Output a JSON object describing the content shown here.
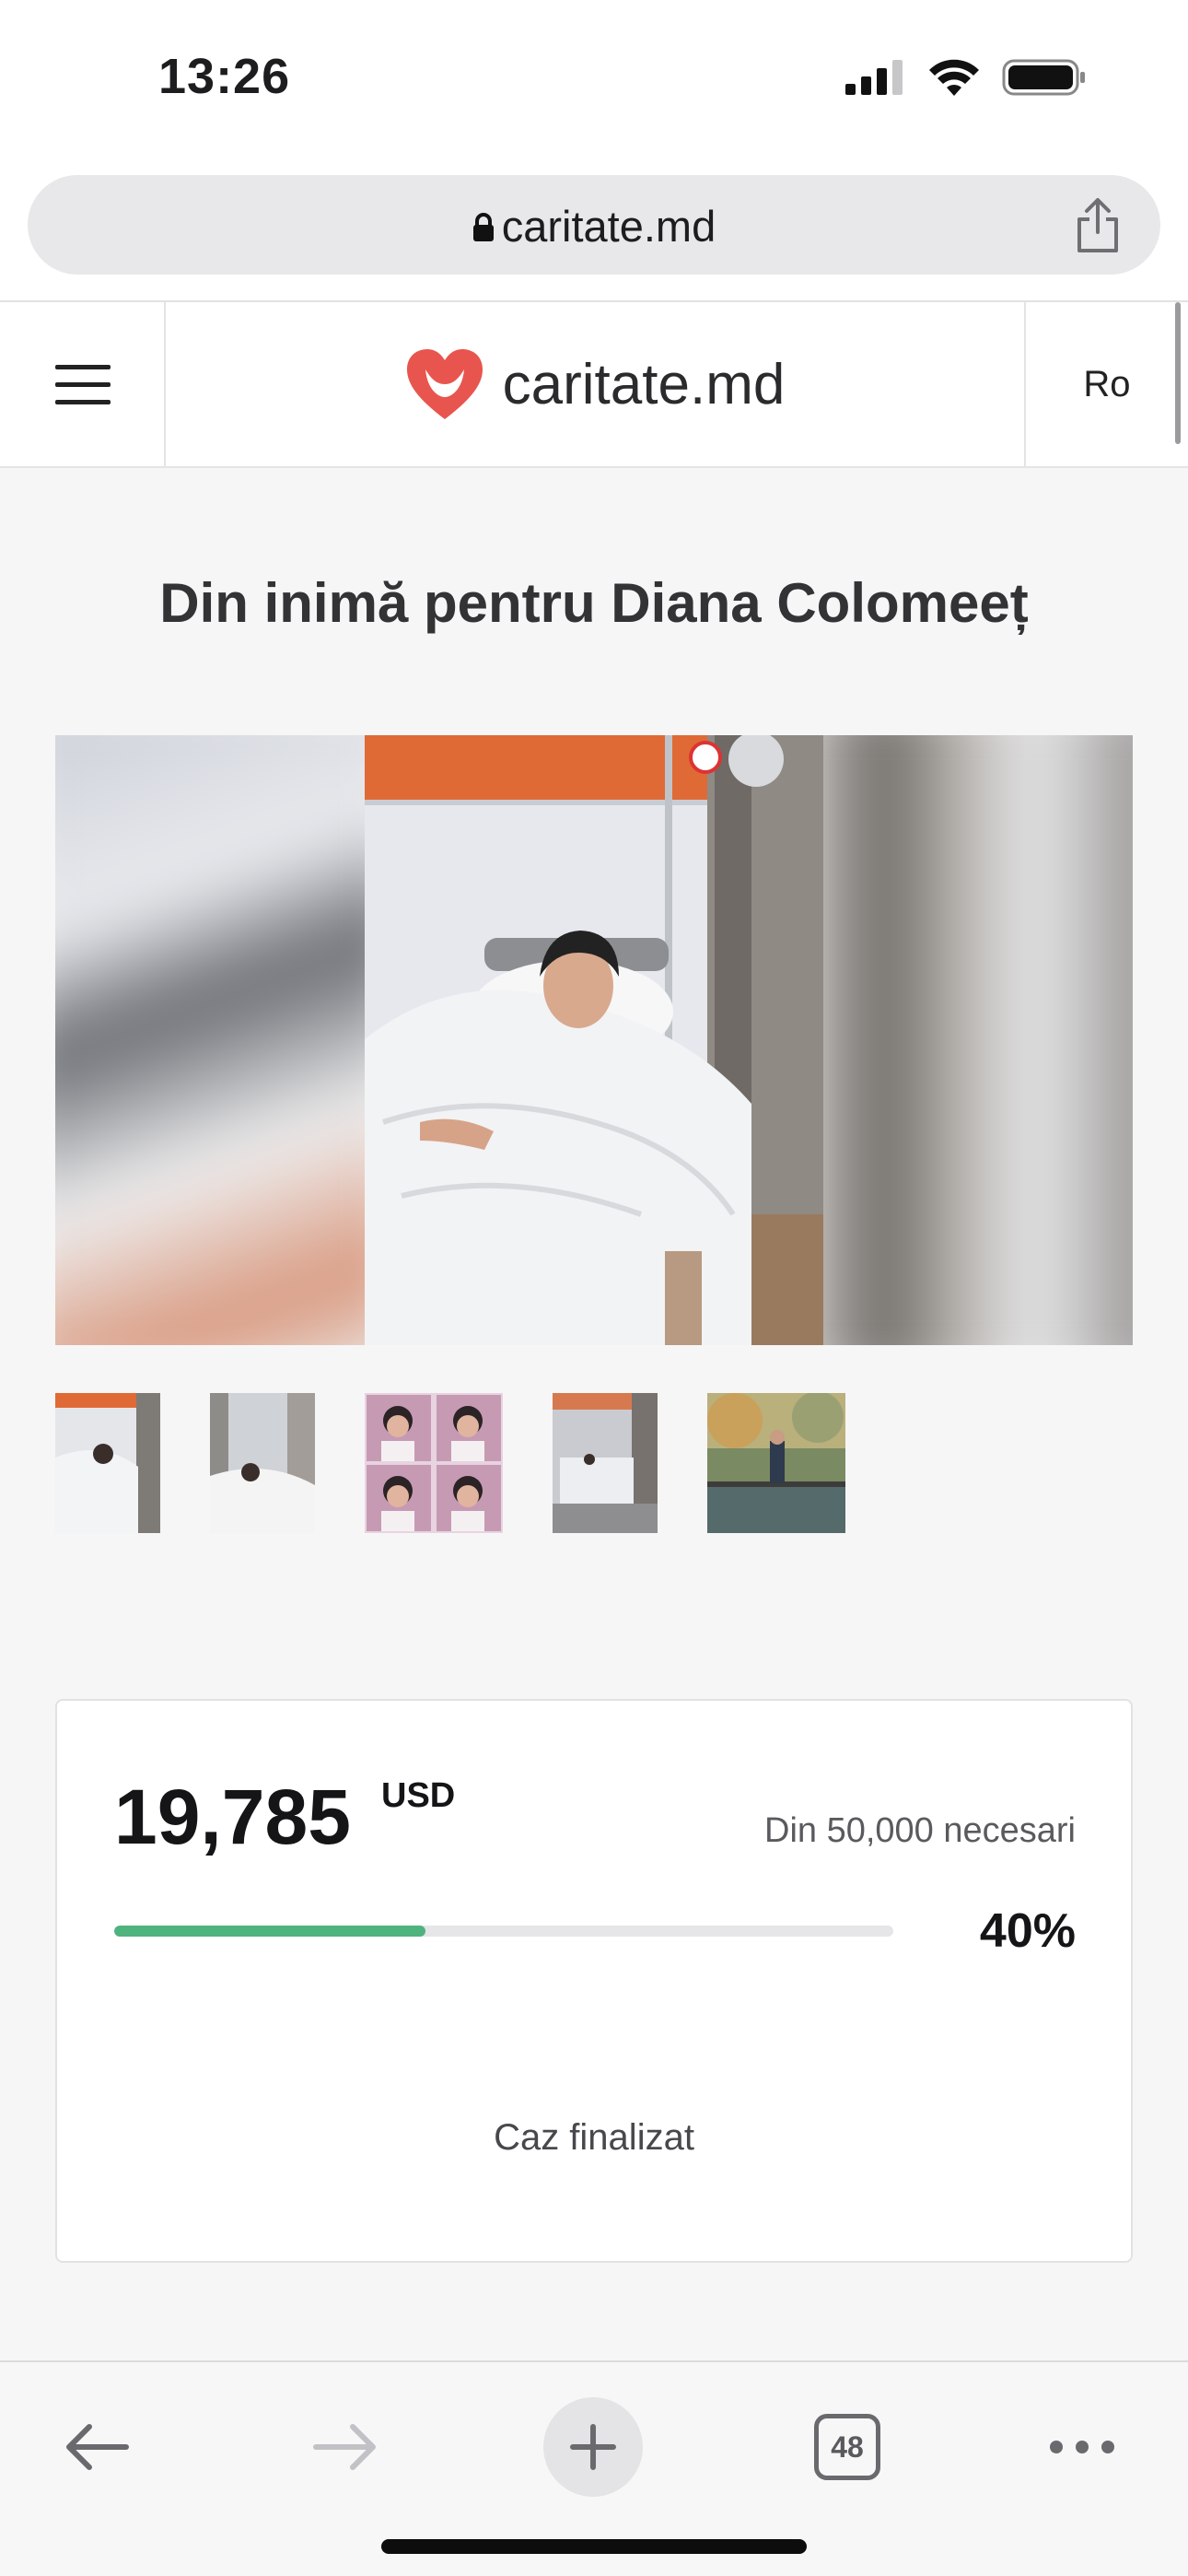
{
  "status_bar": {
    "time": "13:26",
    "signal_icon": "cellular-signal-icon",
    "wifi_icon": "wifi-icon",
    "battery_icon": "battery-icon"
  },
  "url_bar": {
    "url": "caritate.md",
    "lock_icon": "lock-icon",
    "share_icon": "share-icon"
  },
  "header": {
    "menu_icon": "hamburger-menu-icon",
    "logo_icon": "heart-logo-icon",
    "logo_text": "caritate.md",
    "language": "Ro",
    "brand_color": "#e8554e"
  },
  "page": {
    "title": "Din inimă pentru Diana Colomeeț"
  },
  "gallery": {
    "thumbnail_count": 5
  },
  "donation": {
    "raised": "19,785",
    "currency": "USD",
    "goal_text": "Din 50,000 necesari",
    "percent_text": "40%",
    "progress_fraction": 0.4,
    "progress_color": "#4fb37d",
    "status": "Caz finalizat"
  },
  "toolbar": {
    "back_icon": "back-arrow-icon",
    "forward_icon": "forward-arrow-icon",
    "new_tab_icon": "plus-icon",
    "tab_count": "48",
    "more_icon": "more-dots-icon"
  }
}
